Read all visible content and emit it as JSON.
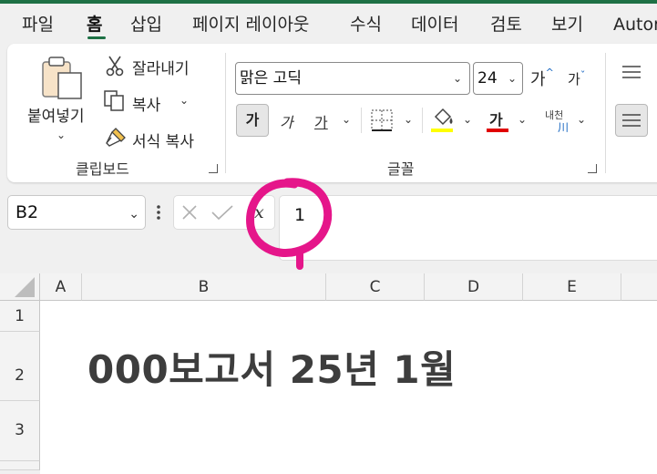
{
  "menu": {
    "tabs": [
      {
        "label": "파일"
      },
      {
        "label": "홈",
        "active": true
      },
      {
        "label": "삽입"
      },
      {
        "label": "페이지 레이아웃"
      },
      {
        "label": "수식"
      },
      {
        "label": "데이터"
      },
      {
        "label": "검토"
      },
      {
        "label": "보기"
      },
      {
        "label": "Autor"
      }
    ]
  },
  "ribbon": {
    "clipboard": {
      "paste_label": "붙여넣기",
      "cut_label": "잘라내기",
      "copy_label": "복사",
      "format_painter_label": "서식 복사",
      "group_label": "클립보드"
    },
    "font": {
      "font_name": "맑은 고딕",
      "font_size": "24",
      "grow_label": "가",
      "shrink_label": "가",
      "bold_label": "가",
      "italic_label": "가",
      "underline_label": "가",
      "font_color_label": "가",
      "phonetic_label": "내천",
      "group_label": "글꼴",
      "fill_color": "#ffff00",
      "font_color": "#e00000"
    }
  },
  "formula_bar": {
    "name_box": "B2",
    "fx_label": "fx",
    "value": "1",
    "annotation_color": "#e5168a"
  },
  "grid": {
    "columns": [
      "A",
      "B",
      "C",
      "D",
      "E"
    ],
    "rows": [
      "1",
      "2",
      "3"
    ],
    "b2_text": "000보고서 25년 1월"
  }
}
